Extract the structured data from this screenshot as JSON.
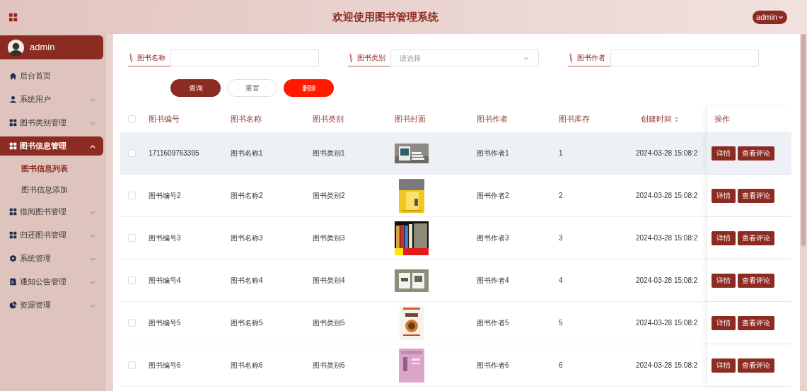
{
  "header": {
    "title": "欢迎使用图书管理系统",
    "user_menu": "admin"
  },
  "sidebar": {
    "user": "admin",
    "items": [
      {
        "label": "后台首页",
        "selected": false
      },
      {
        "label": "系统用户",
        "selected": false,
        "expanded": false
      },
      {
        "label": "图书类别管理",
        "selected": false,
        "expanded": false
      },
      {
        "label": "图书信息管理",
        "selected": true,
        "expanded": true,
        "children": [
          {
            "label": "图书信息列表",
            "selected": true
          },
          {
            "label": "图书信息添加",
            "selected": false
          }
        ]
      },
      {
        "label": "借阅图书管理",
        "selected": false,
        "expanded": false
      },
      {
        "label": "归还图书管理",
        "selected": false,
        "expanded": false
      },
      {
        "label": "系统管理",
        "selected": false,
        "expanded": false
      },
      {
        "label": "通知公告管理",
        "selected": false,
        "expanded": false
      },
      {
        "label": "资源管理",
        "selected": false,
        "expanded": false
      }
    ]
  },
  "search": {
    "fields": [
      {
        "label": "图书名称",
        "kind": "text"
      },
      {
        "label": "图书类别",
        "kind": "select",
        "placeholder": "请选择"
      },
      {
        "label": "图书作者",
        "kind": "text"
      }
    ],
    "buttons": [
      {
        "label": "查询",
        "kind": "primary"
      },
      {
        "label": "重置",
        "kind": "default"
      },
      {
        "label": "删除",
        "kind": "danger"
      }
    ]
  },
  "table": {
    "select_all": {
      "checked": false
    },
    "columns": [
      {
        "label": "图书编号",
        "sortable": false
      },
      {
        "label": "图书名称",
        "sortable": false
      },
      {
        "label": "图书类别",
        "sortable": false
      },
      {
        "label": "图书封面",
        "sortable": false
      },
      {
        "label": "图书作者",
        "sortable": false
      },
      {
        "label": "图书库存",
        "sortable": false
      },
      {
        "label": "创建时间",
        "sortable": true
      },
      {
        "label": "操作",
        "sortable": false
      }
    ],
    "rows": [
      {
        "checked": false,
        "hovered": true,
        "cells": [
          "1711609763395",
          "图书名称1",
          "图书类别1",
          "",
          "图书作者1",
          "1",
          "2024-03-28 15:08:2"
        ],
        "actions": [
          "详情",
          "查看评论"
        ]
      },
      {
        "checked": false,
        "hovered": false,
        "cells": [
          "图书编号2",
          "图书名称2",
          "图书类别2",
          "",
          "图书作者2",
          "2",
          "2024-03-28 15:08:2"
        ],
        "actions": [
          "详情",
          "查看评论"
        ]
      },
      {
        "checked": false,
        "hovered": false,
        "cells": [
          "图书编号3",
          "图书名称3",
          "图书类别3",
          "",
          "图书作者3",
          "3",
          "2024-03-28 15:08:2"
        ],
        "actions": [
          "详情",
          "查看评论"
        ]
      },
      {
        "checked": false,
        "hovered": false,
        "cells": [
          "图书编号4",
          "图书名称4",
          "图书类别4",
          "",
          "图书作者4",
          "4",
          "2024-03-28 15:08:2"
        ],
        "actions": [
          "详情",
          "查看评论"
        ]
      },
      {
        "checked": false,
        "hovered": false,
        "cells": [
          "图书编号5",
          "图书名称5",
          "图书类别5",
          "",
          "图书作者5",
          "5",
          "2024-03-28 15:08:2"
        ],
        "actions": [
          "详情",
          "查看评论"
        ]
      },
      {
        "checked": false,
        "hovered": false,
        "cells": [
          "图书编号6",
          "图书名称6",
          "图书类别6",
          "",
          "图书作者6",
          "6",
          "2024-03-28 15:08:2"
        ],
        "actions": [
          "详情",
          "查看评论"
        ]
      }
    ]
  }
}
